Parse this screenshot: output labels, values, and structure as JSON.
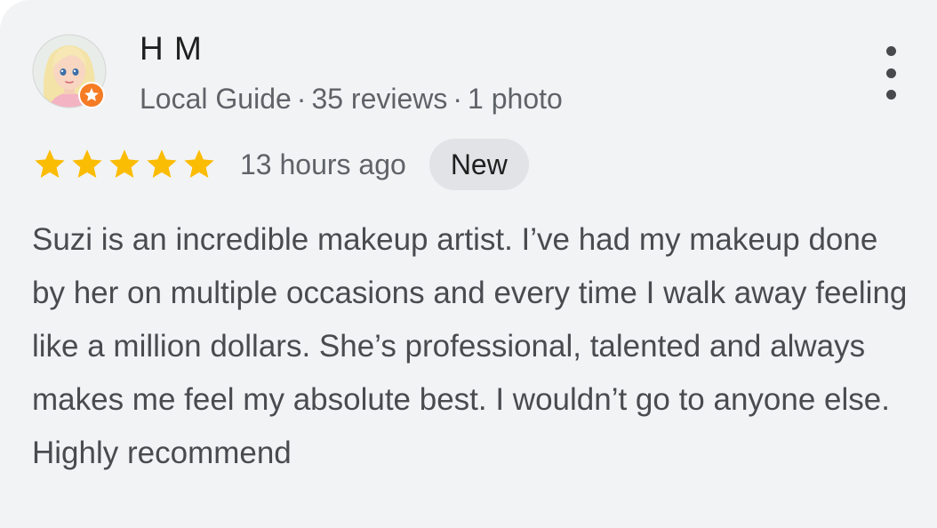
{
  "review": {
    "reviewer_name": "H M",
    "reviewer_badge": "Local Guide",
    "separator": "·",
    "review_count": "35 reviews",
    "photo_count": "1 photo",
    "rating": 5,
    "rating_max": 5,
    "time_ago": "13 hours ago",
    "new_badge": "New",
    "text": "Suzi is an incredible makeup artist. I’ve had my makeup done by her on multiple occasions and every time I walk away feeling like a million dollars. She’s professional, talented and always makes me feel my absolute best. I wouldn’t go to anyone else. Highly recommend"
  },
  "icons": {
    "avatar": "cartoon-woman-avatar",
    "guide_badge": "local-guide-star-icon",
    "more": "more-vert-icon",
    "star": "star-icon"
  },
  "colors": {
    "card_background": "#f2f3f5",
    "star": "#fbbc04",
    "guide_badge": "#f57c25",
    "new_badge_background": "#e1e3e6"
  }
}
